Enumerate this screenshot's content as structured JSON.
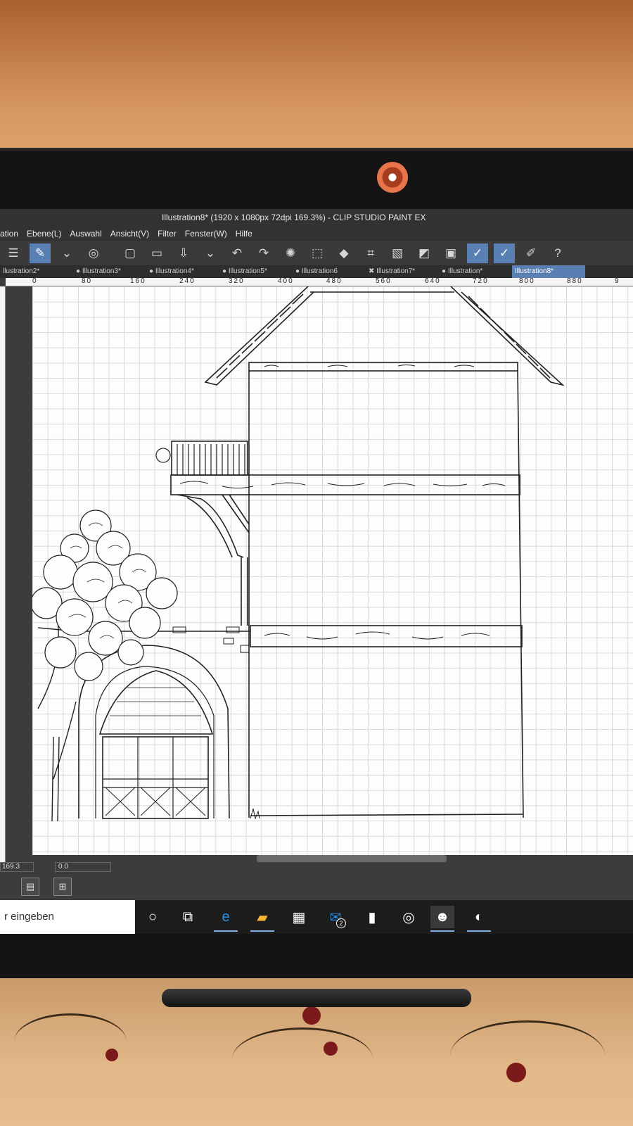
{
  "window": {
    "title": "Illustration8* (1920 x 1080px 72dpi 169.3%)  - CLIP STUDIO PAINT EX"
  },
  "menu": [
    "ation",
    "Ebene(L)",
    "Auswahl",
    "Ansicht(V)",
    "Filter",
    "Fenster(W)",
    "Hilfe"
  ],
  "toolbar": {
    "icons": [
      "menu-icon",
      "brush-tool-icon",
      "chevron-down-icon",
      "swirl-icon",
      "new-canvas-icon",
      "open-folder-icon",
      "save-icon",
      "chevron-down-icon",
      "undo-icon",
      "redo-icon",
      "spinner-icon",
      "selection-icon",
      "fill-icon",
      "transform-icon",
      "clear-icon",
      "fill-gray-icon",
      "frame-icon",
      "pen-check-icon",
      "brush-check-icon",
      "pen-line-icon",
      "help-icon"
    ]
  },
  "tabs": [
    {
      "label": "llustration2*",
      "marker": ""
    },
    {
      "label": "Illustration3*",
      "marker": "●"
    },
    {
      "label": "Illustration4*",
      "marker": "●"
    },
    {
      "label": "Illustration5*",
      "marker": "●"
    },
    {
      "label": "Illustration6",
      "marker": "●"
    },
    {
      "label": "Illustration7*",
      "marker": "✖"
    },
    {
      "label": "Illustration*",
      "marker": "●"
    },
    {
      "label": "Illustration8*",
      "marker": "●"
    }
  ],
  "ruler": {
    "labels": [
      "0",
      "80",
      "160",
      "240",
      "320",
      "400",
      "480",
      "560",
      "640",
      "720",
      "800",
      "880",
      "9"
    ]
  },
  "status": {
    "zoom": "169.3",
    "angle": "0.0"
  },
  "taskbar": {
    "search_placeholder": "r eingeben",
    "mail_badge": "2"
  },
  "colors": {
    "accent": "#5a7fb3",
    "chrome": "#3c3c3c",
    "canvas": "#fdfdfd",
    "webcam_ring": "#e8744a"
  }
}
